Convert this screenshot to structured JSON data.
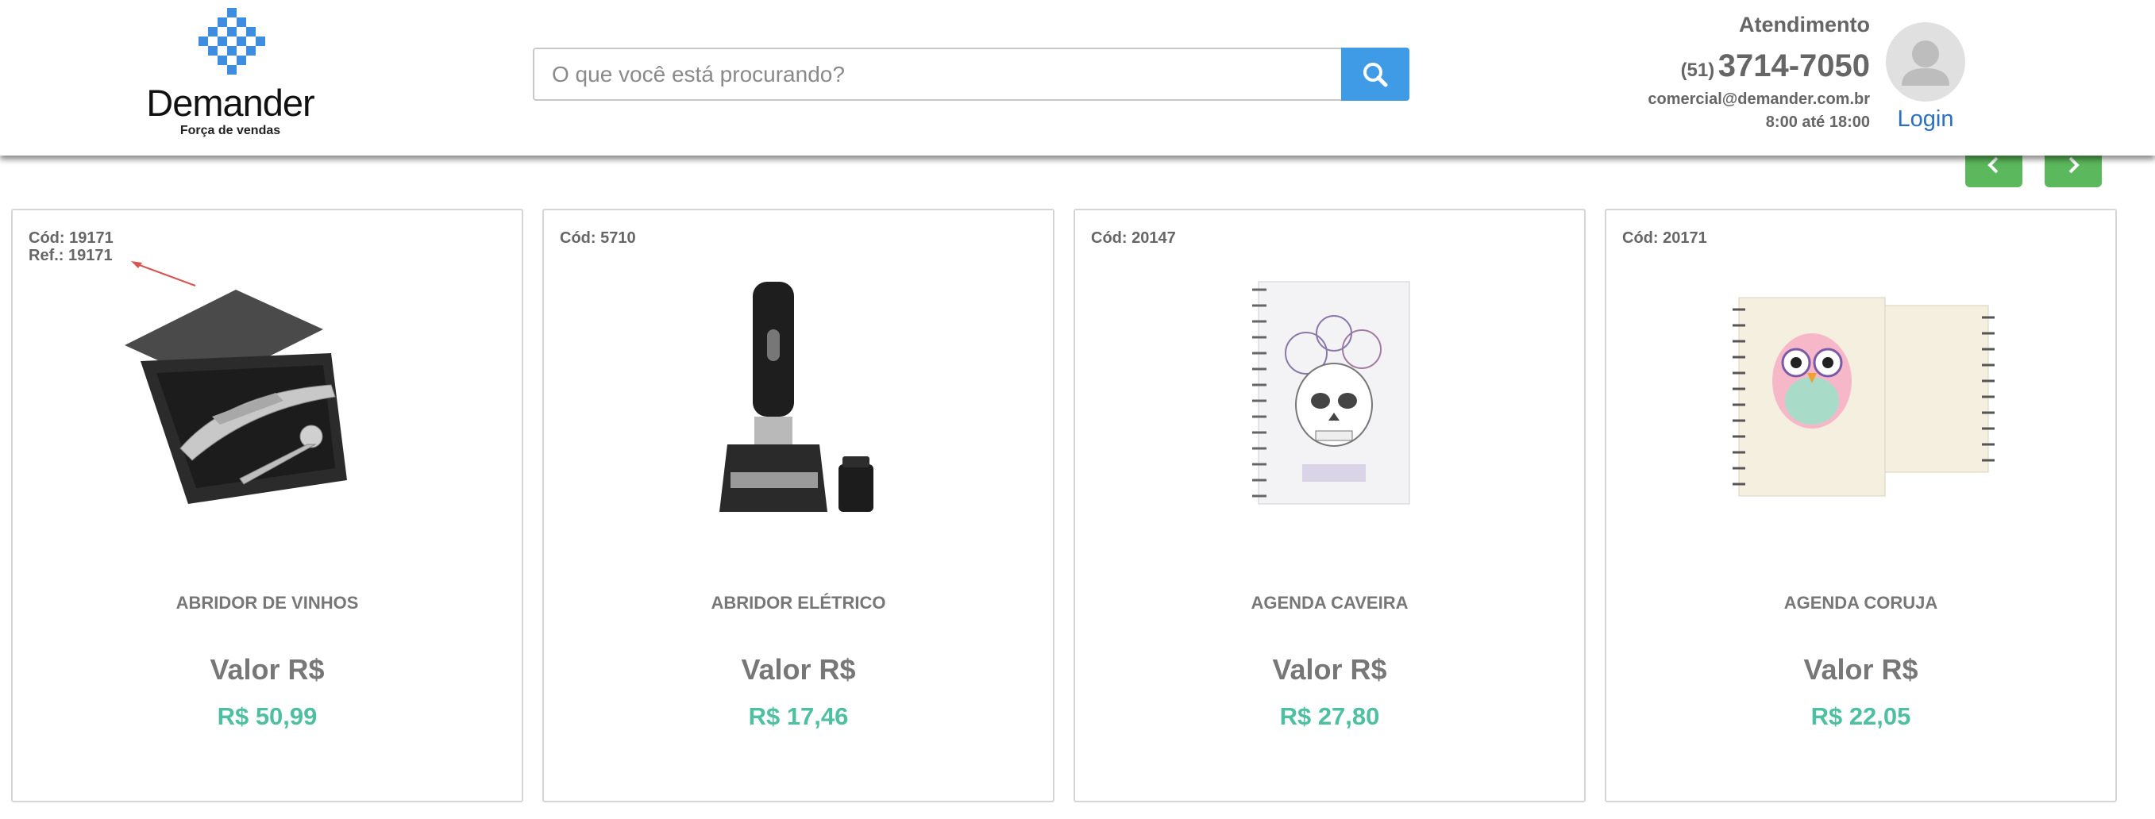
{
  "header": {
    "logo": {
      "name": "Demander",
      "tagline": "Força de vendas"
    },
    "search": {
      "placeholder": "O que você está procurando?",
      "value": ""
    },
    "contact": {
      "title": "Atendimento",
      "phone_area": "(51)",
      "phone_number": "3714-7050",
      "email": "comercial@demander.com.br",
      "hours": "8:00 até 18:00"
    },
    "login_label": "Login"
  },
  "colors": {
    "accent_blue": "#3f9be6",
    "nav_green": "#5cb85c",
    "price_teal": "#4fbfa1",
    "login_blue": "#2a6fc2"
  },
  "products": [
    {
      "code": "Cód: 19171",
      "ref": "Ref.: 19171",
      "name": "ABRIDOR DE VINHOS",
      "valor_label": "Valor R$",
      "price": "R$ 50,99",
      "image": "wine-opener-set"
    },
    {
      "code": "Cód: 5710",
      "ref": "",
      "name": "ABRIDOR ELÉTRICO",
      "valor_label": "Valor R$",
      "price": "R$ 17,46",
      "image": "electric-opener"
    },
    {
      "code": "Cód: 20147",
      "ref": "",
      "name": "AGENDA CAVEIRA",
      "valor_label": "Valor R$",
      "price": "R$ 27,80",
      "image": "skull-planner"
    },
    {
      "code": "Cód: 20171",
      "ref": "",
      "name": "AGENDA CORUJA",
      "valor_label": "Valor R$",
      "price": "R$ 22,05",
      "image": "owl-planner"
    }
  ]
}
